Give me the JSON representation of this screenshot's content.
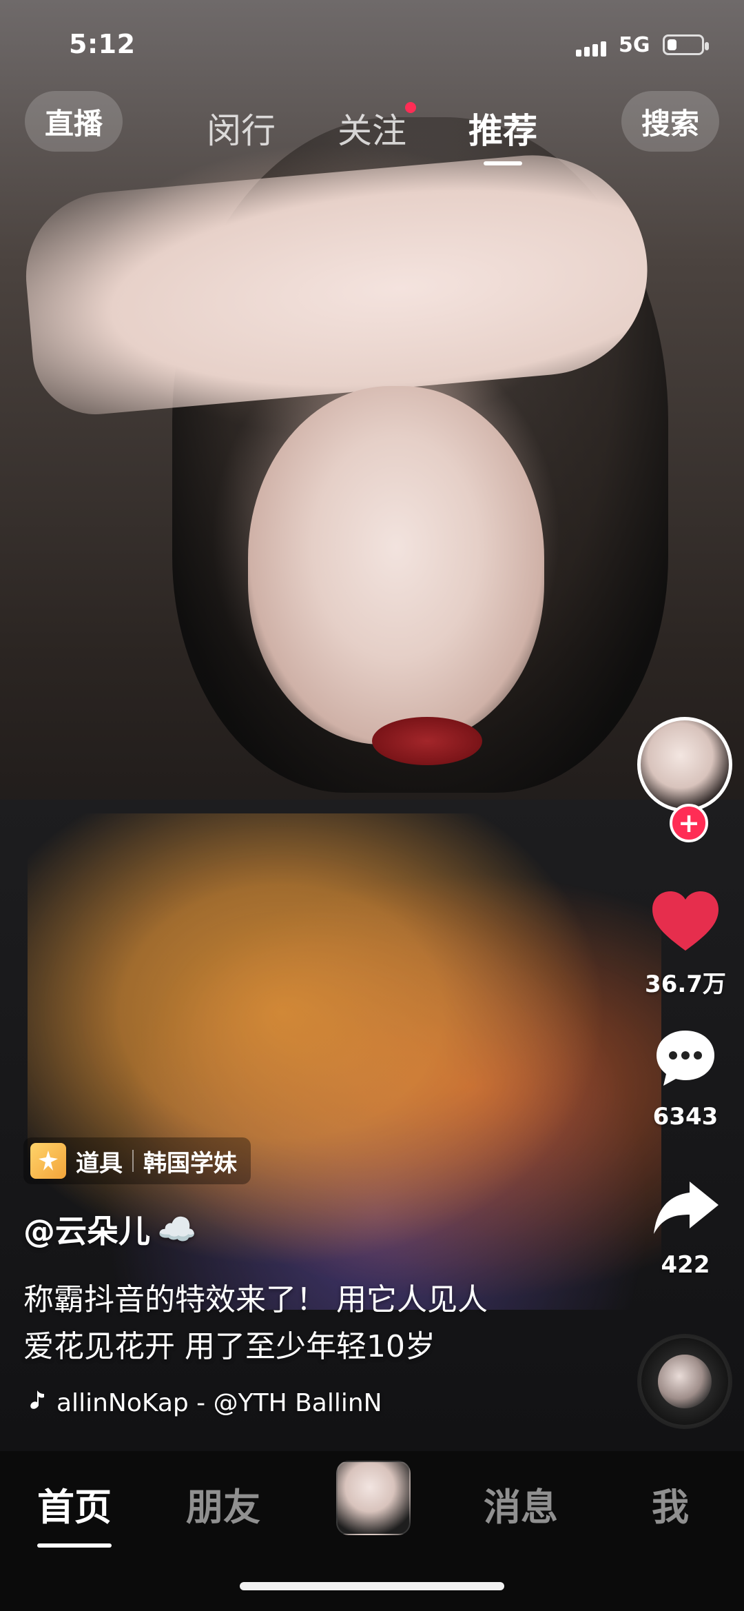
{
  "status_bar": {
    "time": "5:12",
    "network": "5G",
    "battery_level": 0.28
  },
  "top_tabs": {
    "live_label": "直播",
    "tabs": [
      {
        "label": "闵行"
      },
      {
        "label": "关注"
      },
      {
        "label": "推荐"
      }
    ],
    "search_label": "搜索"
  },
  "right_actions": {
    "likes": "36.7万",
    "comments": "6343",
    "shares": "422",
    "follow_symbol": "+"
  },
  "video_info": {
    "prop_label": "道具",
    "prop_name": "韩国学妹",
    "author": "@云朵儿",
    "author_emoji": "☁️",
    "description_line1": "称霸抖音的特效来了！ 用它人见人",
    "description_line2": "爱花见花开 用了至少年轻10岁",
    "music": "allinNoKap - @YTH BallinN"
  },
  "bottom_nav": {
    "items": [
      {
        "label": "首页"
      },
      {
        "label": "朋友"
      },
      {
        "label": "消息"
      },
      {
        "label": "我"
      }
    ]
  },
  "colors": {
    "accent_red": "#ff2d55",
    "like_red": "#e62e4d"
  }
}
